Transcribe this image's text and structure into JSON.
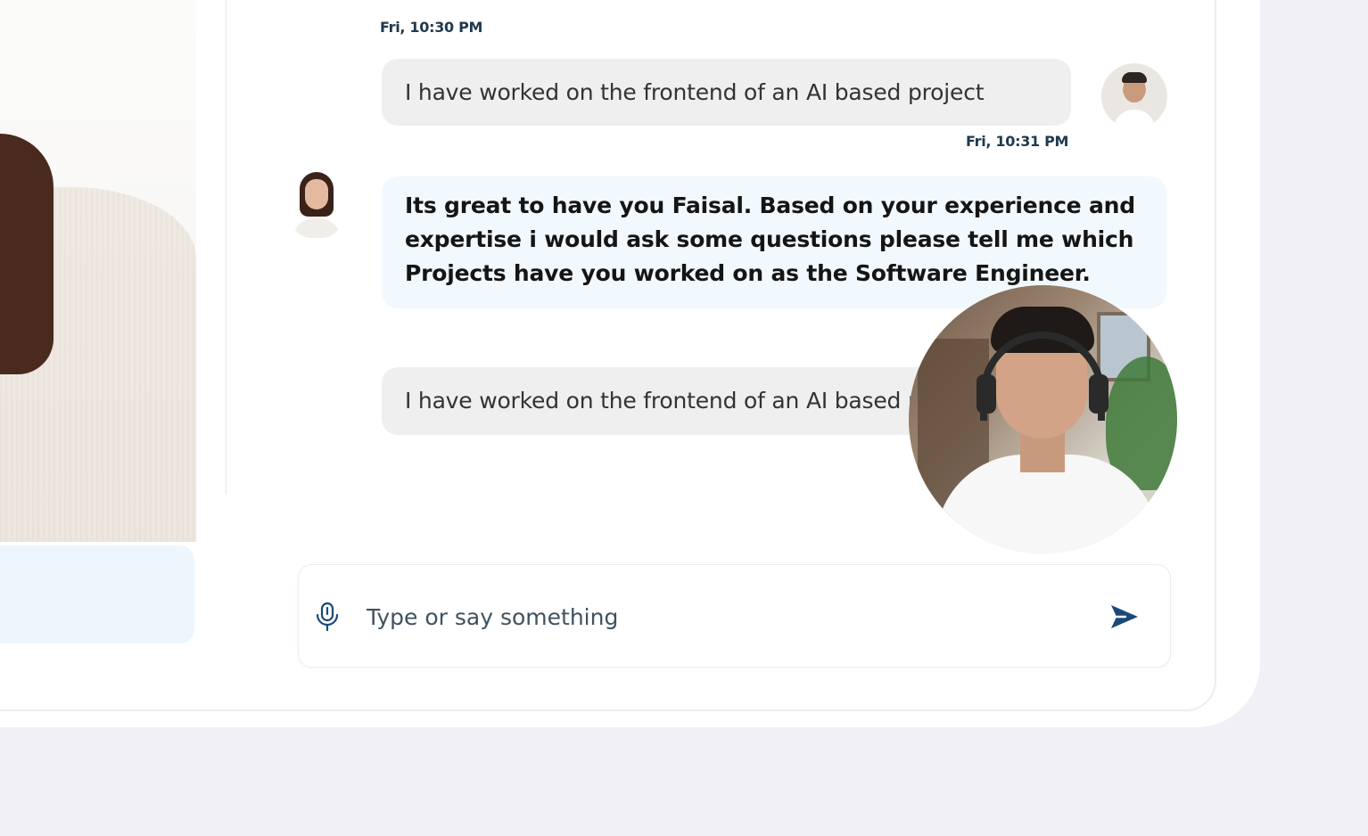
{
  "chat": {
    "messages": [
      {
        "role": "user",
        "time": "Fri, 10:30 PM",
        "text": "I have worked on the frontend of an AI based project"
      },
      {
        "role": "ai",
        "time": "Fri, 10:31 PM",
        "text": "Its great to have you Faisal. Based on your experience and expertise i would ask some questions please tell me which Projects have you worked on as the Software Engineer."
      },
      {
        "role": "user",
        "text": "I have worked on the frontend of an AI based project"
      }
    ]
  },
  "input": {
    "placeholder": "Type or say something"
  },
  "icons": {
    "mic": "microphone-icon",
    "send": "send-icon"
  },
  "colors": {
    "accent": "#1a4a7a",
    "ai_bubble": "#f1f8fe",
    "user_bubble": "#efefef",
    "background": "#f1f0f7"
  }
}
